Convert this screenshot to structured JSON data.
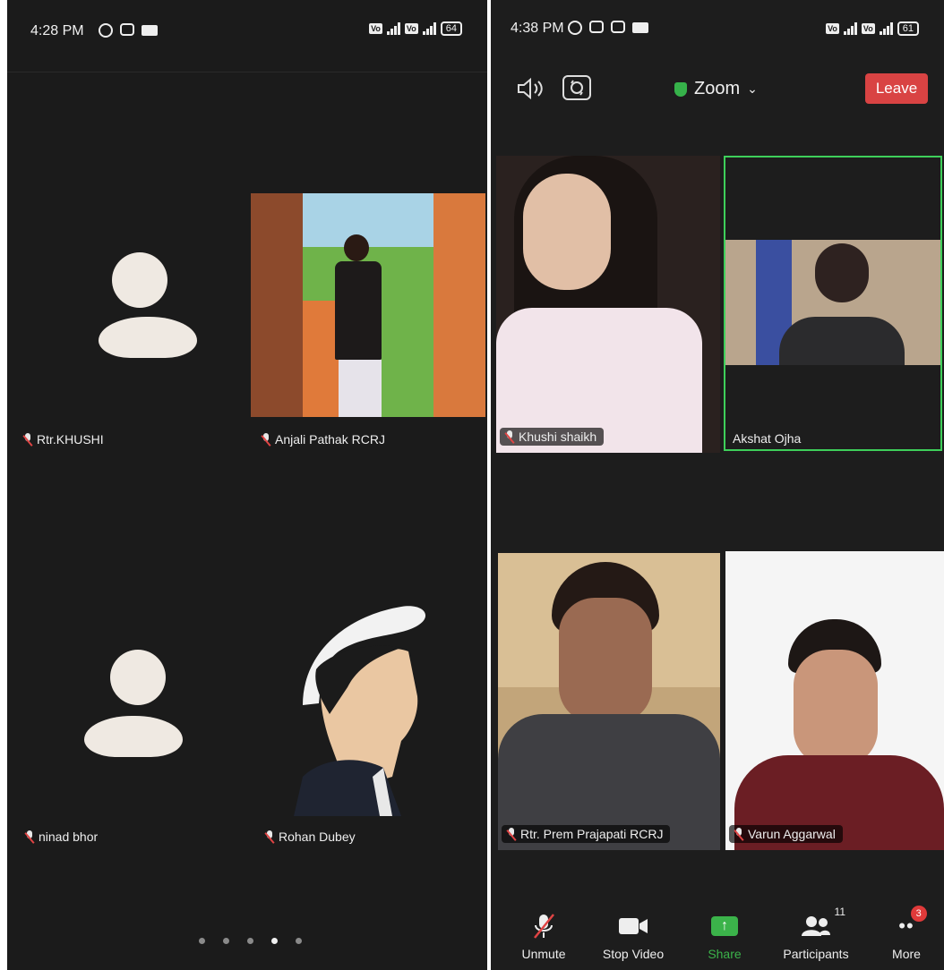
{
  "left_screen": {
    "status": {
      "time": "4:28 PM",
      "battery": "64"
    },
    "participants": [
      {
        "name": "Rtr.KHUSHI",
        "video": "avatar"
      },
      {
        "name": "Anjali Pathak RCRJ",
        "video": "photo"
      },
      {
        "name": "ninad bhor",
        "video": "avatar"
      },
      {
        "name": "Rohan Dubey",
        "video": "illustration"
      }
    ],
    "pages": 5,
    "active_page": 4
  },
  "right_screen": {
    "status": {
      "time": "4:38 PM",
      "battery": "61"
    },
    "meeting_title": "Zoom",
    "leave_label": "Leave",
    "participants": [
      {
        "name": "Khushi shaikh",
        "video": "camera"
      },
      {
        "name": "Akshat Ojha",
        "video": "camera",
        "active_speaker": true
      },
      {
        "name": "Rtr. Prem Prajapati RCRJ",
        "video": "camera"
      },
      {
        "name": "Varun Aggarwal",
        "video": "camera"
      }
    ],
    "toolbar": {
      "unmute": "Unmute",
      "stop_video": "Stop Video",
      "share": "Share",
      "participants": "Participants",
      "participants_count": "11",
      "more": "More",
      "more_badge": "3"
    }
  },
  "colors": {
    "leave": "#d94343",
    "share": "#3bb34a",
    "active_border": "#3ecf5a",
    "badge": "#e03a3a"
  }
}
